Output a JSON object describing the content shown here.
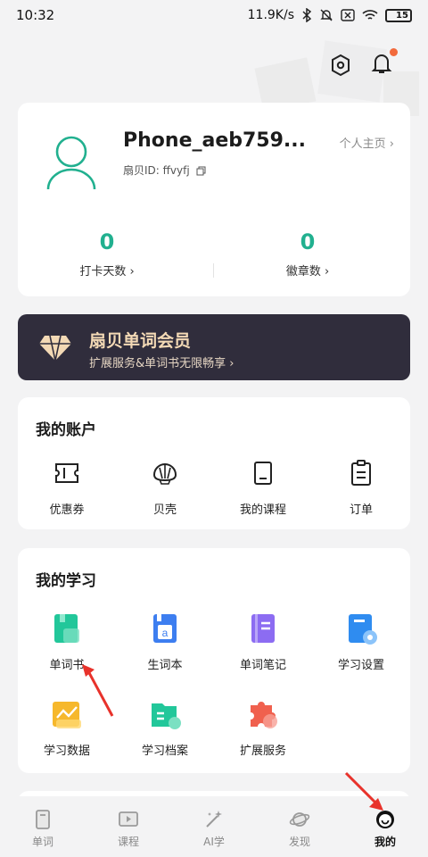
{
  "status_bar": {
    "time": "10:32",
    "network_speed": "11.9K/s",
    "battery": "15"
  },
  "profile": {
    "username": "Phone_aeb759...",
    "homepage_link": "个人主页",
    "user_id_label": "扇贝ID: ffvyfj",
    "stats": [
      {
        "value": "0",
        "label": "打卡天数"
      },
      {
        "value": "0",
        "label": "徽章数"
      }
    ]
  },
  "vip": {
    "title": "扇贝单词会员",
    "subtitle": "扩展服务&单词书无限畅享"
  },
  "account": {
    "title": "我的账户",
    "items": [
      {
        "label": "优惠券",
        "icon": "ticket-icon"
      },
      {
        "label": "贝壳",
        "icon": "shell-icon"
      },
      {
        "label": "我的课程",
        "icon": "book-icon"
      },
      {
        "label": "订单",
        "icon": "clipboard-icon"
      }
    ]
  },
  "study": {
    "title": "我的学习",
    "items": [
      {
        "label": "单词书",
        "icon": "wordbook-icon",
        "color": "#22c79a"
      },
      {
        "label": "生词本",
        "icon": "vocab-notebook-icon",
        "color": "#3d7ef0"
      },
      {
        "label": "单词笔记",
        "icon": "word-notes-icon",
        "color": "#8c6cf2"
      },
      {
        "label": "学习设置",
        "icon": "study-settings-icon",
        "color": "#2f8cf0"
      },
      {
        "label": "学习数据",
        "icon": "study-data-icon",
        "color": "#f6b82c"
      },
      {
        "label": "学习档案",
        "icon": "study-archive-icon",
        "color": "#22c79a"
      },
      {
        "label": "扩展服务",
        "icon": "puzzle-icon",
        "color": "#f0604e"
      }
    ]
  },
  "bottom_nav": [
    {
      "label": "单词",
      "icon": "words-icon"
    },
    {
      "label": "课程",
      "icon": "course-icon"
    },
    {
      "label": "AI学",
      "icon": "ai-wand-icon"
    },
    {
      "label": "发现",
      "icon": "planet-icon"
    },
    {
      "label": "我的",
      "icon": "me-icon",
      "active": true
    }
  ],
  "colors": {
    "accent": "#21b08f",
    "vip_bg": "#302d3c",
    "vip_text": "#f3d9b5",
    "annotation_arrow": "#e8322b"
  }
}
